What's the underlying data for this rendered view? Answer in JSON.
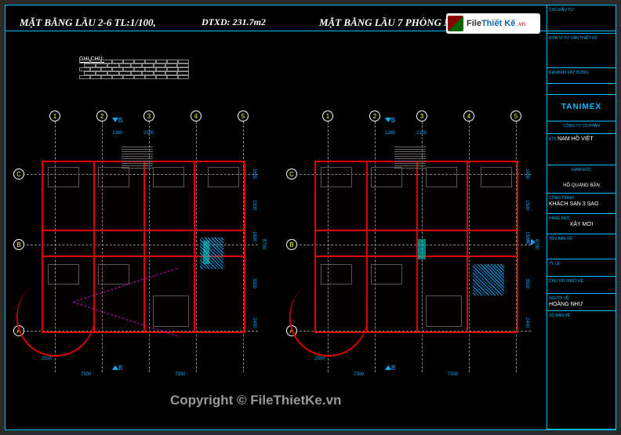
{
  "titles": {
    "left": "MẶT BẰNG LẦU 2-6 TL:1/100,",
    "area": "DTXD: 231.7m2",
    "right": "MẶT BẰNG LẦU 7  PHÒNG NGỦ TL:1/100"
  },
  "notes": {
    "label": "GHI CHÚ:"
  },
  "grid_labels": {
    "cols": [
      "1",
      "2",
      "3",
      "4",
      "5"
    ],
    "rows": [
      "A",
      "B",
      "C"
    ]
  },
  "dimensions": {
    "top": [
      "1380",
      "2100"
    ],
    "right_outer": "8700",
    "right_cells": [
      "1680",
      "1500",
      "1800",
      "3500",
      "2400"
    ],
    "bottom": [
      "7300",
      "7300"
    ],
    "bottom_small": "2500"
  },
  "section_marks": {
    "b1": "B",
    "b2": "B",
    "a": "A"
  },
  "title_block": {
    "company": "TANIMEX",
    "company_sub": "CÔNG TY CỔ PHẦN",
    "consultant_lbl": "ĐƠN VỊ TƯ VẤN THIẾT KẾ:",
    "architect_lbl": "KTS",
    "architect": "NAM HỒ VIỆT",
    "director_lbl": "GIÁM ĐỐC",
    "signed": "HỒ QUANG BẢN",
    "project_lbl": "CÔNG TRÌNH",
    "project": "KHÁCH SẠN 3 SAO",
    "phase_lbl": "HẠNG MỤC:",
    "phase": "XÂY MỚI",
    "drawing_lbl": "TÊN BẢN VẼ:",
    "owner_lbl": "CHỦ ĐẦU TƯ:",
    "scale_lbl": "TỶ LỆ:",
    "checker_lbl": "CHỦ TRÌ THIẾT KẾ:",
    "drafter_lbl": "NGƯỜI VẼ:",
    "drafter": "HOÀNG NHƯ",
    "location_lbl": "ĐỊA ĐIỂM XÂY DỰNG:",
    "sheet_lbl": "SỐ BẢN VẼ"
  },
  "watermark": {
    "brand1": "File",
    "brand2": "Thiết Kế",
    "tld": ".vn",
    "copyright": "Copyright © FileThietKe.vn"
  }
}
